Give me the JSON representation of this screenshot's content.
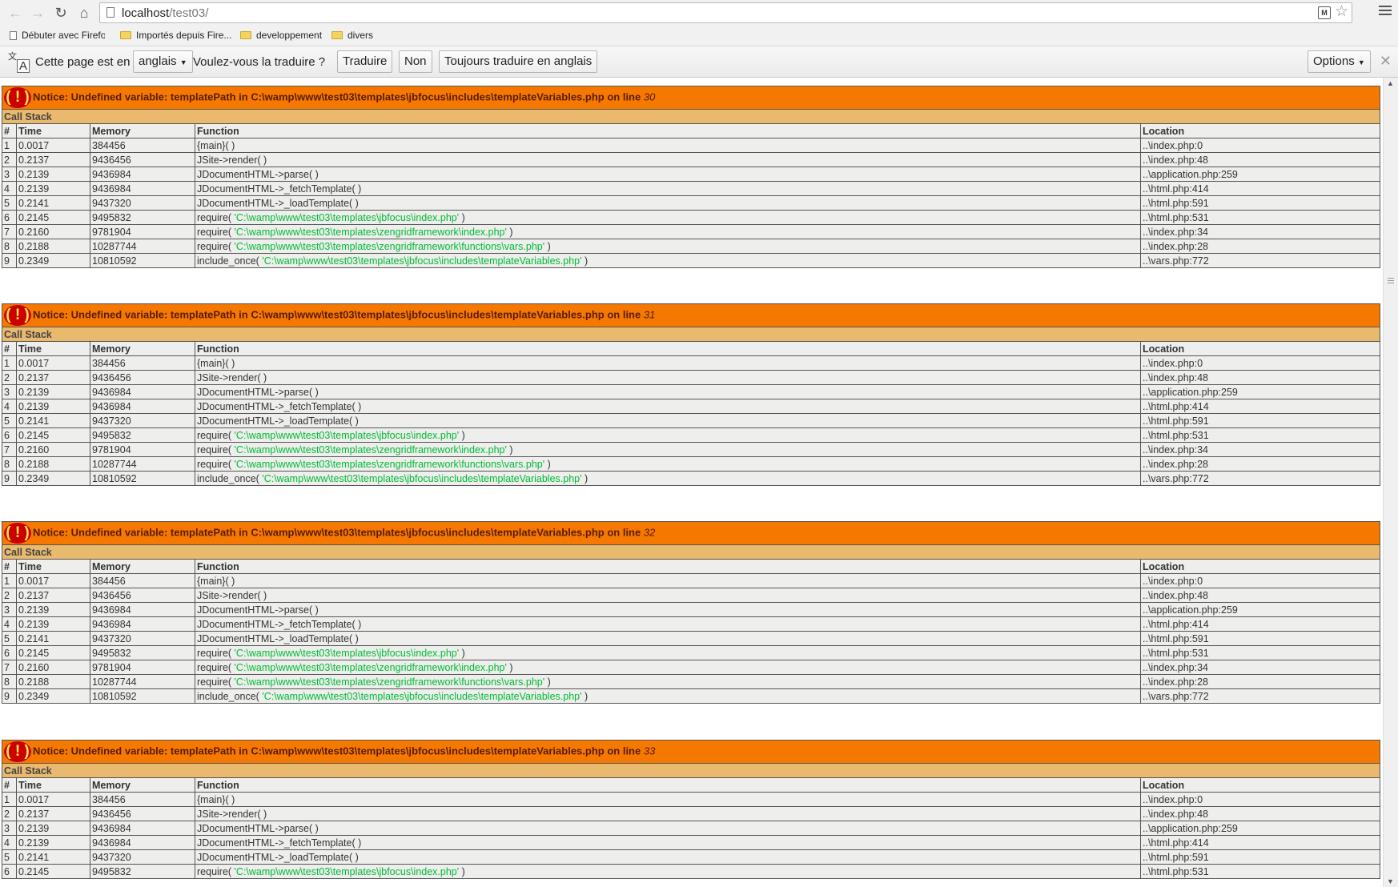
{
  "browser": {
    "url_host": "localhost",
    "url_path": "/test03/",
    "bookmarks": [
      {
        "label": "Débuter avec Firefox",
        "type": "page"
      },
      {
        "label": "Importés depuis Fire...",
        "type": "folder"
      },
      {
        "label": "developpement",
        "type": "folder"
      },
      {
        "label": "divers",
        "type": "folder"
      }
    ]
  },
  "translate": {
    "prefix": "Cette page est en",
    "language": "anglais",
    "question": "Voulez-vous la traduire ?",
    "translate_btn": "Traduire",
    "no_btn": "Non",
    "always_btn": "Toujours traduire en anglais",
    "options_btn": "Options"
  },
  "icons": {
    "nav_back": "arrow-left-icon",
    "nav_forward": "arrow-right-icon",
    "reload": "reload-icon",
    "home": "home-icon",
    "bookmark_star": "star-icon",
    "menu": "hamburger-menu-icon",
    "translate": "translate-icon",
    "close": "close-icon"
  },
  "colors": {
    "error_header": "#f57900",
    "call_stack_header": "#e9b96e",
    "row_background": "#eeeeec",
    "error_badge": "#cc0000",
    "argument_green": "#00bb36"
  },
  "notices": [
    {
      "badge": "( ! )",
      "message": "Notice: Undefined variable: templatePath in C:\\wamp\\www\\test03\\templates\\jbfocus\\includes\\templateVariables.php on line ",
      "line": "30",
      "call_stack_label": "Call Stack",
      "columns": [
        "#",
        "Time",
        "Memory",
        "Function",
        "Location"
      ],
      "rows": [
        {
          "num": "1",
          "time": "0.0017",
          "memory": "384456",
          "fn": "{main}( )",
          "arg": "",
          "fn_end": "",
          "location": "..\\index.php:0"
        },
        {
          "num": "2",
          "time": "0.2137",
          "memory": "9436456",
          "fn": "JSite->render( )",
          "arg": "",
          "fn_end": "",
          "location": "..\\index.php:48"
        },
        {
          "num": "3",
          "time": "0.2139",
          "memory": "9436984",
          "fn": "JDocumentHTML->parse( )",
          "arg": "",
          "fn_end": "",
          "location": "..\\application.php:259"
        },
        {
          "num": "4",
          "time": "0.2139",
          "memory": "9436984",
          "fn": "JDocumentHTML->_fetchTemplate( )",
          "arg": "",
          "fn_end": "",
          "location": "..\\html.php:414"
        },
        {
          "num": "5",
          "time": "0.2141",
          "memory": "9437320",
          "fn": "JDocumentHTML->_loadTemplate( )",
          "arg": "",
          "fn_end": "",
          "location": "..\\html.php:591"
        },
        {
          "num": "6",
          "time": "0.2145",
          "memory": "9495832",
          "fn": "require( ",
          "arg": "'C:\\wamp\\www\\test03\\templates\\jbfocus\\index.php'",
          "fn_end": " )",
          "location": "..\\html.php:531"
        },
        {
          "num": "7",
          "time": "0.2160",
          "memory": "9781904",
          "fn": "require( ",
          "arg": "'C:\\wamp\\www\\test03\\templates\\zengridframework\\index.php'",
          "fn_end": " )",
          "location": "..\\index.php:34"
        },
        {
          "num": "8",
          "time": "0.2188",
          "memory": "10287744",
          "fn": "require( ",
          "arg": "'C:\\wamp\\www\\test03\\templates\\zengridframework\\functions\\vars.php'",
          "fn_end": " )",
          "location": "..\\index.php:28"
        },
        {
          "num": "9",
          "time": "0.2349",
          "memory": "10810592",
          "fn": "include_once( ",
          "arg": "'C:\\wamp\\www\\test03\\templates\\jbfocus\\includes\\templateVariables.php'",
          "fn_end": " )",
          "location": "..\\vars.php:772"
        }
      ]
    },
    {
      "badge": "( ! )",
      "message": "Notice: Undefined variable: templatePath in C:\\wamp\\www\\test03\\templates\\jbfocus\\includes\\templateVariables.php on line ",
      "line": "31",
      "call_stack_label": "Call Stack",
      "columns": [
        "#",
        "Time",
        "Memory",
        "Function",
        "Location"
      ],
      "rows": [
        {
          "num": "1",
          "time": "0.0017",
          "memory": "384456",
          "fn": "{main}( )",
          "arg": "",
          "fn_end": "",
          "location": "..\\index.php:0"
        },
        {
          "num": "2",
          "time": "0.2137",
          "memory": "9436456",
          "fn": "JSite->render( )",
          "arg": "",
          "fn_end": "",
          "location": "..\\index.php:48"
        },
        {
          "num": "3",
          "time": "0.2139",
          "memory": "9436984",
          "fn": "JDocumentHTML->parse( )",
          "arg": "",
          "fn_end": "",
          "location": "..\\application.php:259"
        },
        {
          "num": "4",
          "time": "0.2139",
          "memory": "9436984",
          "fn": "JDocumentHTML->_fetchTemplate( )",
          "arg": "",
          "fn_end": "",
          "location": "..\\html.php:414"
        },
        {
          "num": "5",
          "time": "0.2141",
          "memory": "9437320",
          "fn": "JDocumentHTML->_loadTemplate( )",
          "arg": "",
          "fn_end": "",
          "location": "..\\html.php:591"
        },
        {
          "num": "6",
          "time": "0.2145",
          "memory": "9495832",
          "fn": "require( ",
          "arg": "'C:\\wamp\\www\\test03\\templates\\jbfocus\\index.php'",
          "fn_end": " )",
          "location": "..\\html.php:531"
        },
        {
          "num": "7",
          "time": "0.2160",
          "memory": "9781904",
          "fn": "require( ",
          "arg": "'C:\\wamp\\www\\test03\\templates\\zengridframework\\index.php'",
          "fn_end": " )",
          "location": "..\\index.php:34"
        },
        {
          "num": "8",
          "time": "0.2188",
          "memory": "10287744",
          "fn": "require( ",
          "arg": "'C:\\wamp\\www\\test03\\templates\\zengridframework\\functions\\vars.php'",
          "fn_end": " )",
          "location": "..\\index.php:28"
        },
        {
          "num": "9",
          "time": "0.2349",
          "memory": "10810592",
          "fn": "include_once( ",
          "arg": "'C:\\wamp\\www\\test03\\templates\\jbfocus\\includes\\templateVariables.php'",
          "fn_end": " )",
          "location": "..\\vars.php:772"
        }
      ]
    },
    {
      "badge": "( ! )",
      "message": "Notice: Undefined variable: templatePath in C:\\wamp\\www\\test03\\templates\\jbfocus\\includes\\templateVariables.php on line ",
      "line": "32",
      "call_stack_label": "Call Stack",
      "columns": [
        "#",
        "Time",
        "Memory",
        "Function",
        "Location"
      ],
      "rows": [
        {
          "num": "1",
          "time": "0.0017",
          "memory": "384456",
          "fn": "{main}( )",
          "arg": "",
          "fn_end": "",
          "location": "..\\index.php:0"
        },
        {
          "num": "2",
          "time": "0.2137",
          "memory": "9436456",
          "fn": "JSite->render( )",
          "arg": "",
          "fn_end": "",
          "location": "..\\index.php:48"
        },
        {
          "num": "3",
          "time": "0.2139",
          "memory": "9436984",
          "fn": "JDocumentHTML->parse( )",
          "arg": "",
          "fn_end": "",
          "location": "..\\application.php:259"
        },
        {
          "num": "4",
          "time": "0.2139",
          "memory": "9436984",
          "fn": "JDocumentHTML->_fetchTemplate( )",
          "arg": "",
          "fn_end": "",
          "location": "..\\html.php:414"
        },
        {
          "num": "5",
          "time": "0.2141",
          "memory": "9437320",
          "fn": "JDocumentHTML->_loadTemplate( )",
          "arg": "",
          "fn_end": "",
          "location": "..\\html.php:591"
        },
        {
          "num": "6",
          "time": "0.2145",
          "memory": "9495832",
          "fn": "require( ",
          "arg": "'C:\\wamp\\www\\test03\\templates\\jbfocus\\index.php'",
          "fn_end": " )",
          "location": "..\\html.php:531"
        },
        {
          "num": "7",
          "time": "0.2160",
          "memory": "9781904",
          "fn": "require( ",
          "arg": "'C:\\wamp\\www\\test03\\templates\\zengridframework\\index.php'",
          "fn_end": " )",
          "location": "..\\index.php:34"
        },
        {
          "num": "8",
          "time": "0.2188",
          "memory": "10287744",
          "fn": "require( ",
          "arg": "'C:\\wamp\\www\\test03\\templates\\zengridframework\\functions\\vars.php'",
          "fn_end": " )",
          "location": "..\\index.php:28"
        },
        {
          "num": "9",
          "time": "0.2349",
          "memory": "10810592",
          "fn": "include_once( ",
          "arg": "'C:\\wamp\\www\\test03\\templates\\jbfocus\\includes\\templateVariables.php'",
          "fn_end": " )",
          "location": "..\\vars.php:772"
        }
      ]
    },
    {
      "badge": "( ! )",
      "message": "Notice: Undefined variable: templatePath in C:\\wamp\\www\\test03\\templates\\jbfocus\\includes\\templateVariables.php on line ",
      "line": "33",
      "call_stack_label": "Call Stack",
      "columns": [
        "#",
        "Time",
        "Memory",
        "Function",
        "Location"
      ],
      "rows": [
        {
          "num": "1",
          "time": "0.0017",
          "memory": "384456",
          "fn": "{main}( )",
          "arg": "",
          "fn_end": "",
          "location": "..\\index.php:0"
        },
        {
          "num": "2",
          "time": "0.2137",
          "memory": "9436456",
          "fn": "JSite->render( )",
          "arg": "",
          "fn_end": "",
          "location": "..\\index.php:48"
        },
        {
          "num": "3",
          "time": "0.2139",
          "memory": "9436984",
          "fn": "JDocumentHTML->parse( )",
          "arg": "",
          "fn_end": "",
          "location": "..\\application.php:259"
        },
        {
          "num": "4",
          "time": "0.2139",
          "memory": "9436984",
          "fn": "JDocumentHTML->_fetchTemplate( )",
          "arg": "",
          "fn_end": "",
          "location": "..\\html.php:414"
        },
        {
          "num": "5",
          "time": "0.2141",
          "memory": "9437320",
          "fn": "JDocumentHTML->_loadTemplate( )",
          "arg": "",
          "fn_end": "",
          "location": "..\\html.php:591"
        },
        {
          "num": "6",
          "time": "0.2145",
          "memory": "9495832",
          "fn": "require( ",
          "arg": "'C:\\wamp\\www\\test03\\templates\\jbfocus\\index.php'",
          "fn_end": " )",
          "location": "..\\html.php:531"
        }
      ]
    }
  ]
}
